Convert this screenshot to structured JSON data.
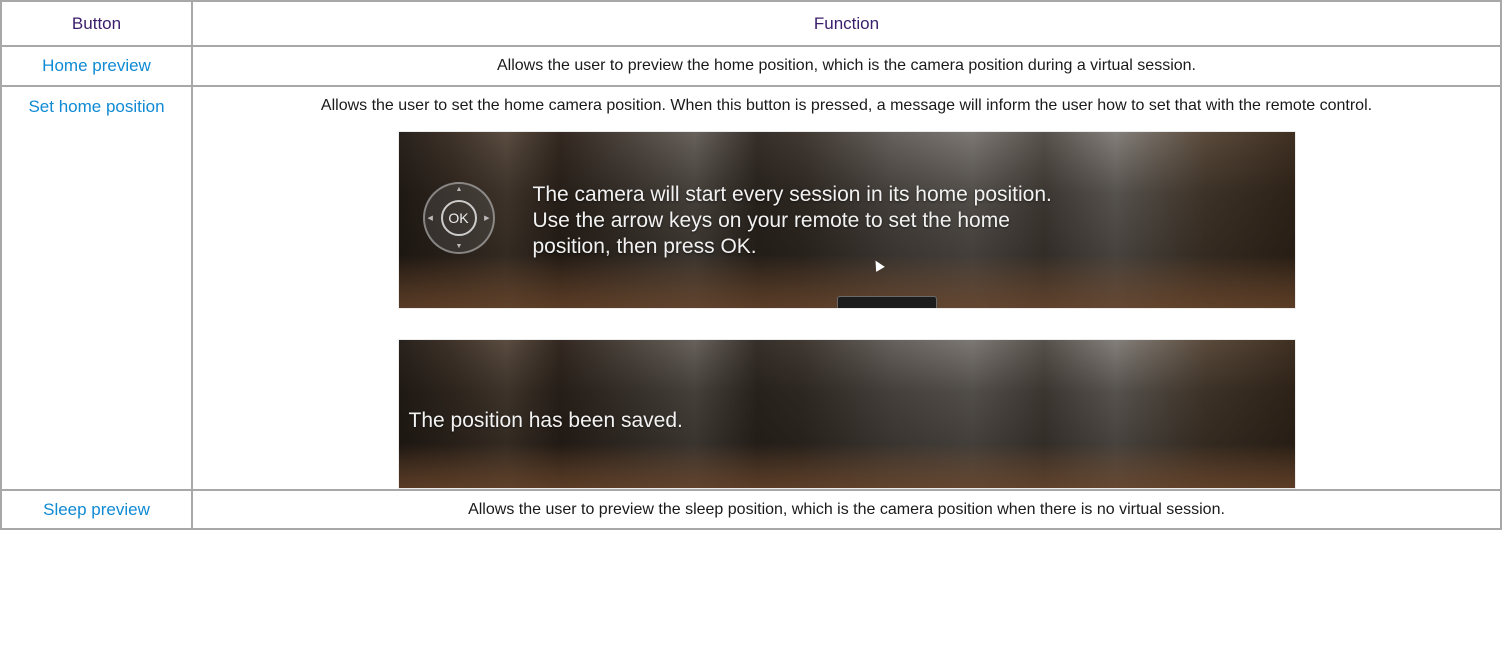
{
  "table": {
    "header": {
      "button": "Button",
      "function": "Function"
    },
    "rows": [
      {
        "button": "Home preview",
        "function": "Allows the user to preview the home position, which is the camera position during a virtual session."
      },
      {
        "button": "Set home position",
        "function": "Allows the user to set the home camera position. When this button is pressed, a message will inform the user how to set that with the remote control.",
        "screenshots": [
          {
            "message": "The camera will start every session in its home position. Use the arrow keys on your remote to set the home position, then press OK.",
            "remote_button_label": "OK",
            "icon": "remote-dpad-icon"
          },
          {
            "message": "The position has been saved."
          }
        ]
      },
      {
        "button": "Sleep preview",
        "function": "Allows the user to preview the sleep position, which is the camera position when there is no virtual session."
      }
    ]
  },
  "colors": {
    "header_text": "#3a1e6b",
    "button_name": "#0f8ad4",
    "border": "#a8a8a8"
  }
}
